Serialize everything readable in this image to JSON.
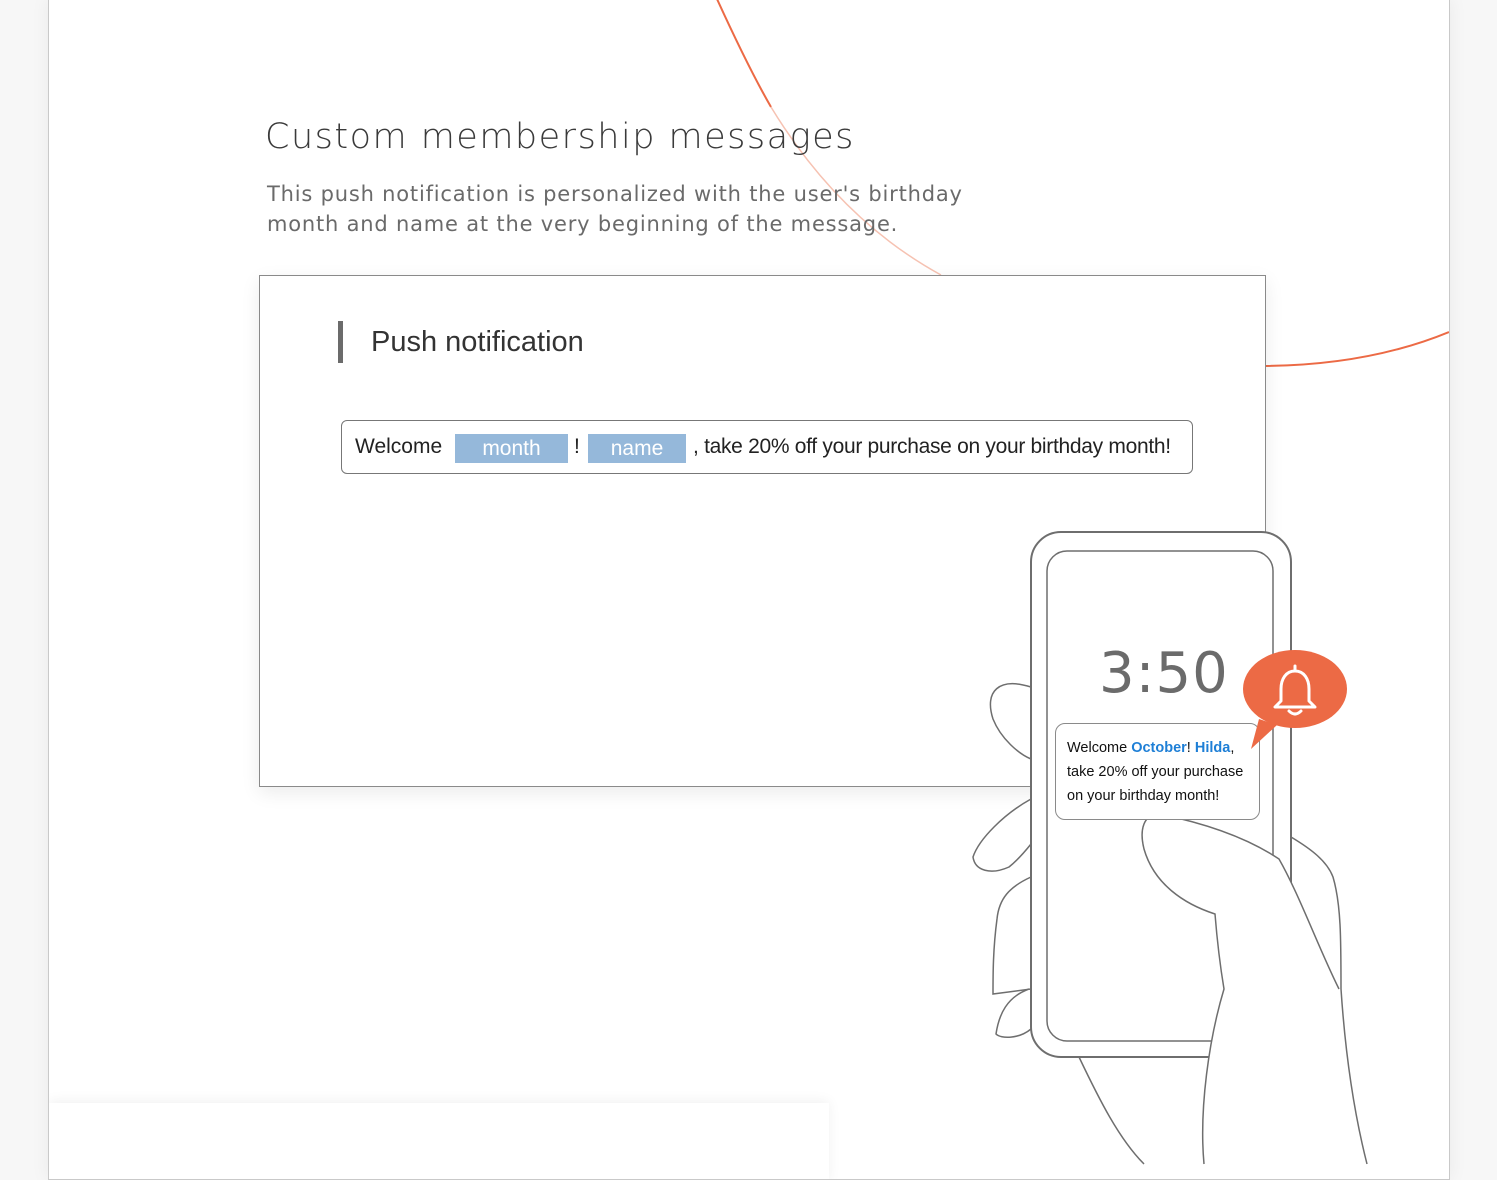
{
  "section": {
    "title": "Custom membership messages",
    "subtitle": "This push notification is personalized with the user's birthday month and name at the very beginning of the message."
  },
  "card": {
    "heading": "Push notification",
    "template": {
      "prefix": "Welcome",
      "token_month": "month",
      "separator": "!",
      "token_name": "name",
      "suffix": ", take 20% off your purchase on your birthday month!"
    }
  },
  "phone": {
    "time": "3:50",
    "notification": {
      "prefix": "Welcome",
      "month": "October",
      "separator": "!",
      "name": "Hilda",
      "suffix": ", take 20% off your purchase on your birthday month!"
    }
  },
  "icons": {
    "bell": "bell-icon",
    "accent_color": "#ec6a45",
    "token_color": "#95b8da",
    "highlight_color": "#1e7fd6"
  }
}
